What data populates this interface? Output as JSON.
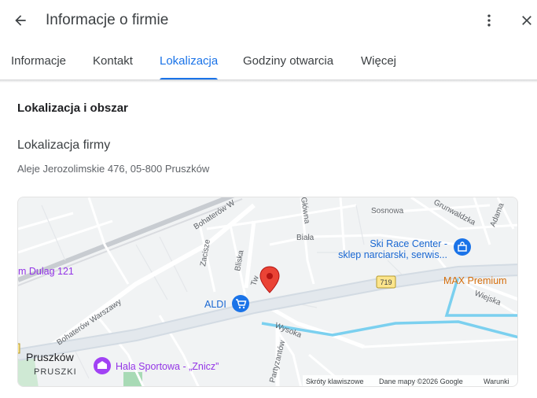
{
  "header": {
    "title": "Informacje o firmie",
    "back_icon": "arrow-left-icon",
    "more_icon": "more-vertical-icon",
    "close_icon": "close-icon"
  },
  "tabs": [
    {
      "label": "Informacje",
      "active": false
    },
    {
      "label": "Kontakt",
      "active": false
    },
    {
      "label": "Lokalizacja",
      "active": true
    },
    {
      "label": "Godziny otwarcia",
      "active": false
    },
    {
      "label": "Więcej",
      "active": false
    }
  ],
  "section": {
    "title": "Lokalizacja i obszar",
    "location_label": "Lokalizacja firmy",
    "address": "Aleje Jerozolimskie 476, 05-800 Pruszków"
  },
  "map": {
    "streets": {
      "bohaterow_top": "Bohaterów W",
      "bohaterow_left": "Bohaterów Warszawy",
      "sosnowa": "Sosnowa",
      "grunwaldzka": "Grunwaldzka",
      "adama": "Adama",
      "glowna": "Główna",
      "biala": "Biała",
      "zacisze": "Zacisze",
      "bliska": "Bliska",
      "tw": "Tw",
      "wysoka": "Wysoka",
      "partyzantow": "Partyzantów",
      "wiejska": "Wiejska"
    },
    "places": {
      "dulag": "m Dulag 121",
      "ski_line1": "Ski Race Center -",
      "ski_line2": "sklep narciarski, serwis...",
      "max": "MAX Premium",
      "aldi": "ALDI",
      "pruszkow": "Pruszków",
      "pruszki": "PRUSZKI",
      "hala": "Hala Sportowa - „Znicz”"
    },
    "road_badge": "719",
    "footer": {
      "shortcuts": "Skróty klawiszowe",
      "data": "Dane mapy ©2026 Google",
      "terms": "Warunki"
    },
    "colors": {
      "accent": "#1a73e8",
      "marker": "#ea4335",
      "shopping": "#1a73e8",
      "sport": "#a142f4",
      "river": "#7bd0ef",
      "highway": "#d3dbe3",
      "label_blue": "#1967d2",
      "label_orange": "#d56e0c",
      "label_purple": "#9334e6"
    }
  }
}
